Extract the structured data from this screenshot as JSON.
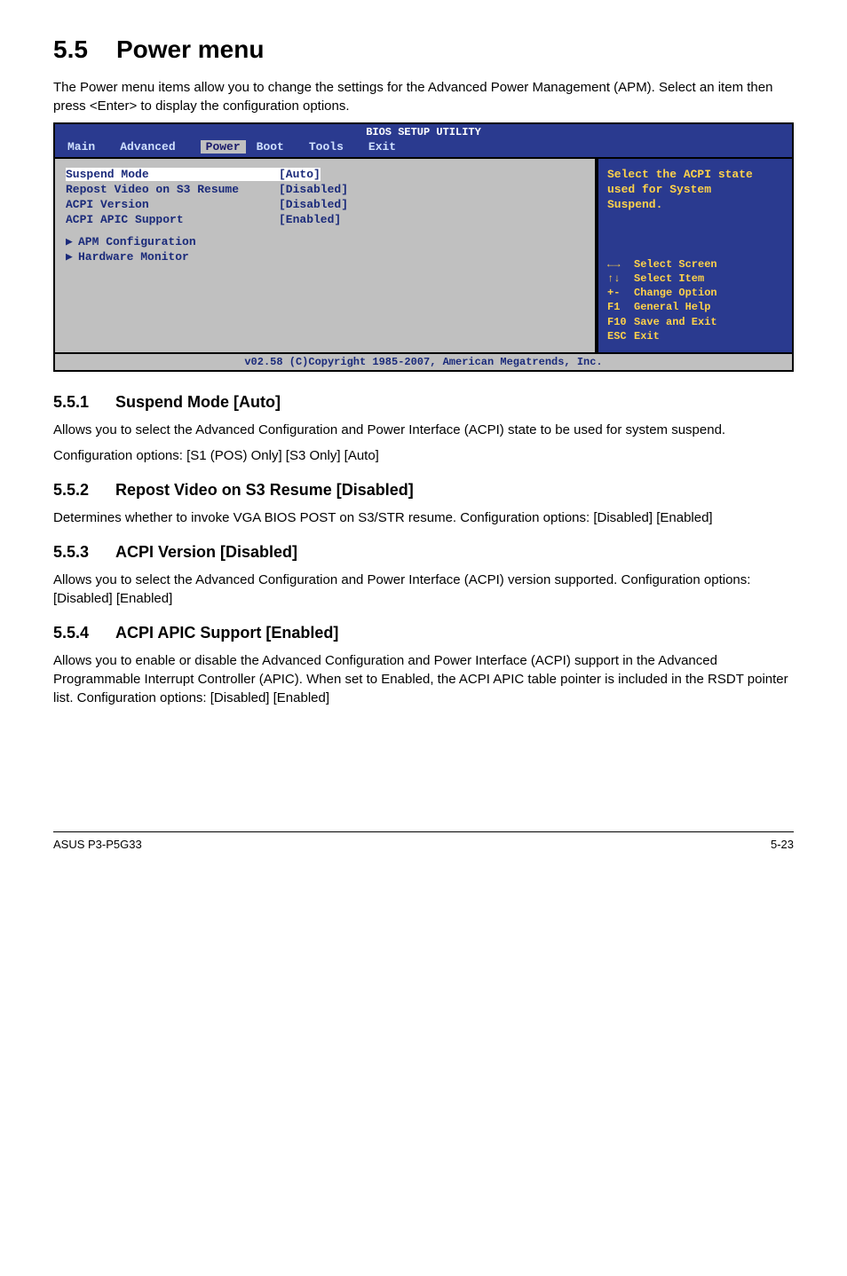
{
  "section": {
    "num": "5.5",
    "title": "Power menu"
  },
  "intro": "The Power menu items allow you to change the settings for the Advanced Power Management (APM). Select an item then press <Enter> to display the configuration options.",
  "bios": {
    "header": "BIOS SETUP UTILITY",
    "tabs": {
      "main": "Main",
      "advanced": "Advanced",
      "power": "Power",
      "boot": "Boot",
      "tools": "Tools",
      "exit": "Exit"
    },
    "rows": {
      "suspend": {
        "label": "Suspend Mode",
        "val": "[Auto]"
      },
      "repost": {
        "label": "Repost Video on S3 Resume",
        "val": "[Disabled]"
      },
      "acpiver": {
        "label": "ACPI Version",
        "val": "[Disabled]"
      },
      "acpiapic": {
        "label": "ACPI APIC Support",
        "val": "[Enabled]"
      }
    },
    "subs": {
      "apm": "APM Configuration",
      "hw": "Hardware Monitor"
    },
    "help": {
      "l1": "Select the ACPI state",
      "l2": "used for System",
      "l3": "Suspend."
    },
    "legend": {
      "selscreen": "Select Screen",
      "selitem": "Select Item",
      "chg": "Change Option",
      "gh": "General Help",
      "se": "Save and Exit",
      "ex": "Exit",
      "k_arrows_h": "←→",
      "k_arrows_v": "↑↓",
      "k_pm": "+-",
      "k_f1": "F1",
      "k_f10": "F10",
      "k_esc": "ESC"
    },
    "footer": "v02.58 (C)Copyright 1985-2007, American Megatrends, Inc."
  },
  "s551": {
    "num": "5.5.1",
    "title": "Suspend Mode [Auto]",
    "p1": "Allows you to select the Advanced Configuration and Power Interface (ACPI) state to be used for system suspend.",
    "p2": "Configuration options: [S1 (POS) Only] [S3 Only] [Auto]"
  },
  "s552": {
    "num": "5.5.2",
    "title": "Repost Video on S3 Resume [Disabled]",
    "p1": "Determines whether to invoke VGA BIOS POST on S3/STR resume. Configuration options: [Disabled] [Enabled]"
  },
  "s553": {
    "num": "5.5.3",
    "title": "ACPI Version [Disabled]",
    "p1": "Allows you to select the Advanced Configuration and Power Interface (ACPI) version supported. Configuration options: [Disabled] [Enabled]"
  },
  "s554": {
    "num": "5.5.4",
    "title": "ACPI APIC Support [Enabled]",
    "p1": "Allows you to enable or disable the Advanced Configuration and Power Interface (ACPI) support in the Advanced Programmable Interrupt Controller (APIC). When set to Enabled, the ACPI APIC table pointer is included in the RSDT pointer list. Configuration options: [Disabled] [Enabled]"
  },
  "footer": {
    "left": "ASUS P3-P5G33",
    "right": "5-23"
  }
}
